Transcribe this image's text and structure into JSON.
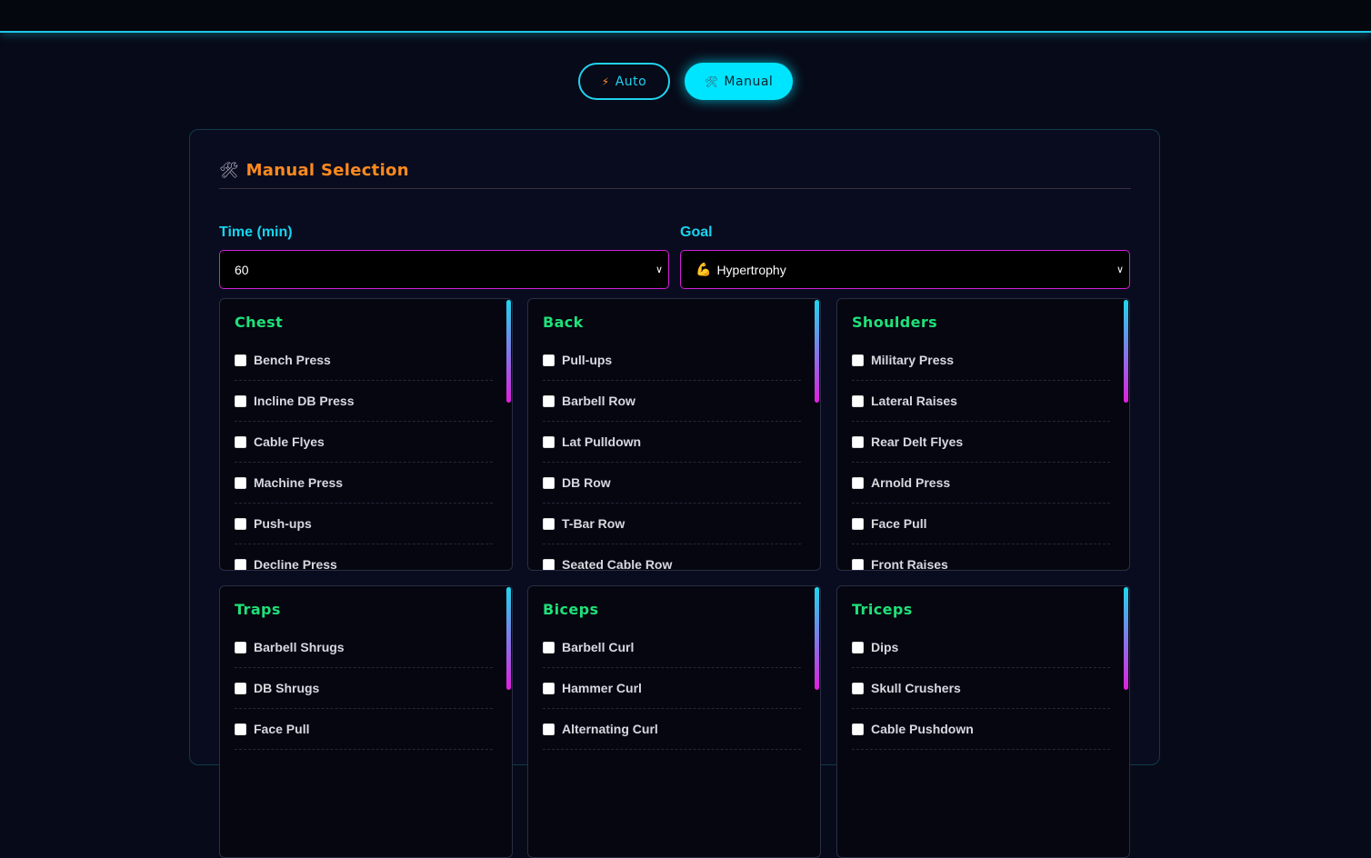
{
  "mode_toggle": {
    "auto": {
      "icon": "lightning-icon",
      "glyph": "⚡",
      "label": "Auto"
    },
    "manual": {
      "icon": "tools-icon",
      "glyph": "🛠",
      "label": "Manual"
    }
  },
  "panel": {
    "icon": "tools-icon",
    "glyph": "🛠",
    "title": "Manual Selection"
  },
  "form": {
    "time_label": "Time (min)",
    "time_value": "60",
    "goal_label": "Goal",
    "goal_emoji": "💪",
    "goal_value": "Hypertrophy"
  },
  "groups": [
    {
      "name": "Chest",
      "items": [
        "Bench Press",
        "Incline DB Press",
        "Cable Flyes",
        "Machine Press",
        "Push-ups",
        "Decline Press"
      ]
    },
    {
      "name": "Back",
      "items": [
        "Pull-ups",
        "Barbell Row",
        "Lat Pulldown",
        "DB Row",
        "T-Bar Row",
        "Seated Cable Row"
      ]
    },
    {
      "name": "Shoulders",
      "items": [
        "Military Press",
        "Lateral Raises",
        "Rear Delt Flyes",
        "Arnold Press",
        "Face Pull",
        "Front Raises"
      ]
    },
    {
      "name": "Traps",
      "items": [
        "Barbell Shrugs",
        "DB Shrugs",
        "Face Pull"
      ]
    },
    {
      "name": "Biceps",
      "items": [
        "Barbell Curl",
        "Hammer Curl",
        "Alternating Curl"
      ]
    },
    {
      "name": "Triceps",
      "items": [
        "Dips",
        "Skull Crushers",
        "Cable Pushdown"
      ]
    }
  ],
  "colors": {
    "accent_cyan": "#00e5ff",
    "title_orange": "#ff8a1f",
    "group_green": "#1fe07a",
    "select_border": "#d21fd6"
  }
}
